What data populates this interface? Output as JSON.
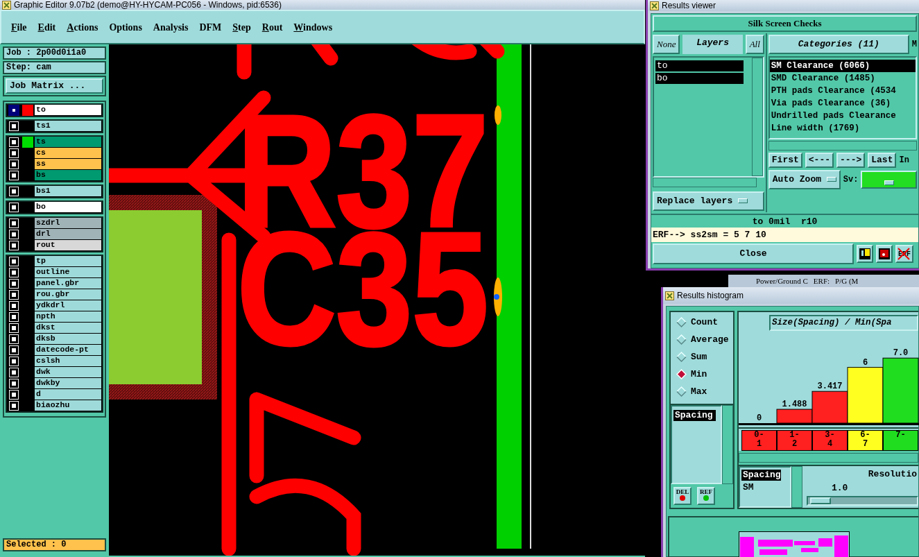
{
  "editor": {
    "title": "Graphic Editor 9.07b2 (demo@HY-HYCAM-PC056 - Windows, pid:6536)",
    "menu": [
      {
        "label": "File",
        "mnemonic": true
      },
      {
        "label": "Edit",
        "mnemonic": true
      },
      {
        "label": "Actions",
        "mnemonic": true
      },
      {
        "label": "Options",
        "mnemonic": false
      },
      {
        "label": "Analysis",
        "mnemonic": false
      },
      {
        "label": "DFM",
        "mnemonic": false
      },
      {
        "label": "Step",
        "mnemonic": true
      },
      {
        "label": "Rout",
        "mnemonic": true
      },
      {
        "label": "Windows",
        "mnemonic": true
      }
    ],
    "job": "Job : 2p00d0i1a0",
    "step": "Step: cam",
    "job_matrix_button": "Job Matrix ...",
    "layer_groups": [
      [
        {
          "name": "to",
          "color": "#ffffff",
          "swatch": {
            "color": "#ff0000"
          },
          "affected": true
        }
      ],
      [
        {
          "name": "ts1",
          "color": "#9fdada",
          "affected": false
        }
      ],
      [
        {
          "name": "ts",
          "color": "#009a70",
          "swatch": {
            "color": "#00dd00"
          },
          "affected": false
        },
        {
          "name": "cs",
          "color": "#ffc24c",
          "affected": false
        },
        {
          "name": "ss",
          "color": "#ffc24c",
          "affected": false
        },
        {
          "name": "bs",
          "color": "#009a70",
          "affected": false
        }
      ],
      [
        {
          "name": "bs1",
          "color": "#9fdada",
          "affected": false
        }
      ],
      [
        {
          "name": "bo",
          "color": "#ffffff",
          "affected": false
        }
      ],
      [
        {
          "name": "szdrl",
          "color": "#a0b4b8",
          "affected": false
        },
        {
          "name": "drl",
          "color": "#a0b4b8",
          "affected": false
        },
        {
          "name": "rout",
          "color": "#d8d8d8",
          "affected": false
        }
      ],
      [
        {
          "name": "tp",
          "color": "#9fdada",
          "affected": false
        },
        {
          "name": "outline",
          "color": "#9fdada",
          "affected": false
        },
        {
          "name": "panel.gbr",
          "color": "#9fdada",
          "affected": false
        },
        {
          "name": "rou.gbr",
          "color": "#9fdada",
          "affected": false
        },
        {
          "name": "ydkdrl",
          "color": "#9fdada",
          "affected": false
        },
        {
          "name": "npth",
          "color": "#9fdada",
          "affected": false
        },
        {
          "name": "dkst",
          "color": "#9fdada",
          "affected": false
        },
        {
          "name": "dksb",
          "color": "#9fdada",
          "affected": false
        },
        {
          "name": "datecode-pt",
          "color": "#9fdada",
          "affected": false
        },
        {
          "name": "cslsh",
          "color": "#9fdada",
          "affected": false
        },
        {
          "name": "dwk",
          "color": "#9fdada",
          "affected": false
        },
        {
          "name": "dwkby",
          "color": "#9fdada",
          "affected": false
        },
        {
          "name": "d",
          "color": "#9fdada",
          "affected": false
        },
        {
          "name": "biaozhu",
          "color": "#9fdada",
          "affected": false
        }
      ]
    ],
    "selected_count": "Selected : 0",
    "canvas": {
      "labels": [
        "R37",
        "C35"
      ]
    }
  },
  "results_viewer": {
    "title": "Results viewer",
    "header": "Silk Screen Checks",
    "layer_buttons": [
      "None",
      "Layers",
      "All"
    ],
    "layers": [
      {
        "label": "to",
        "selected": true
      },
      {
        "label": "bo",
        "selected": true
      }
    ],
    "replace_dropdown": "Replace layers",
    "categories_button": "Categories (11)",
    "categories_cut": "M",
    "categories": [
      {
        "label": "SM Clearance (6066)",
        "selected": true
      },
      {
        "label": "SMD Clearance (1485)",
        "selected": false
      },
      {
        "label": "PTH pads Clearance (4534",
        "selected": false
      },
      {
        "label": "Via pads Clearance (36)",
        "selected": false
      },
      {
        "label": "Undrilled pads Clearance",
        "selected": false
      },
      {
        "label": "Line width (1769)",
        "selected": false
      }
    ],
    "nav_buttons": [
      "First",
      "<---",
      "--->",
      "Last"
    ],
    "nav_cut": "In",
    "zoom_dropdown": "Auto Zoom",
    "sv_label": "Sv:",
    "status": "to 0mil  r10",
    "erf_line": "ERF--> ss2sm = 5 7 10",
    "close_button": "Close",
    "erf_icon_label": "ERF"
  },
  "background_window": {
    "texts": [
      "Power/Ground C",
      "ERF:",
      "P/G (M"
    ]
  },
  "histogram": {
    "title": "Results histogram",
    "modes": [
      {
        "label": "Count",
        "selected": false
      },
      {
        "label": "Average",
        "selected": false
      },
      {
        "label": "Sum",
        "selected": false
      },
      {
        "label": "Min",
        "selected": true
      },
      {
        "label": "Max",
        "selected": false
      }
    ],
    "attributes": [
      {
        "label": "Spacing",
        "selected": true
      }
    ],
    "chart_title": "Size(Spacing) / Min(Spa",
    "bins": [
      {
        "color": "#ff2020"
      },
      {
        "color": "#ff2020"
      },
      {
        "color": "#ff2020"
      },
      {
        "color": "#ffff20"
      },
      {
        "color": "#20dd20"
      }
    ],
    "chart_data": {
      "type": "bar",
      "categories": [
        "0-1",
        "1-2",
        "3-4",
        "6-7",
        "7-"
      ],
      "values": [
        0,
        1.488,
        3.417,
        6,
        7.0
      ],
      "value_labels": [
        "0",
        "1.488",
        "3.417",
        "6",
        "7.0"
      ]
    },
    "sources": [
      {
        "label": "Spacing",
        "selected": true
      },
      {
        "label": "SM",
        "selected": false
      }
    ],
    "resolution_label": "Resolutio",
    "resolution_value": "1.0",
    "resolution": {
      "level": 0.02
    },
    "buttons": [
      {
        "label": "DEL",
        "color": "#e00000"
      },
      {
        "label": "REF",
        "color": "#00c000"
      }
    ]
  }
}
